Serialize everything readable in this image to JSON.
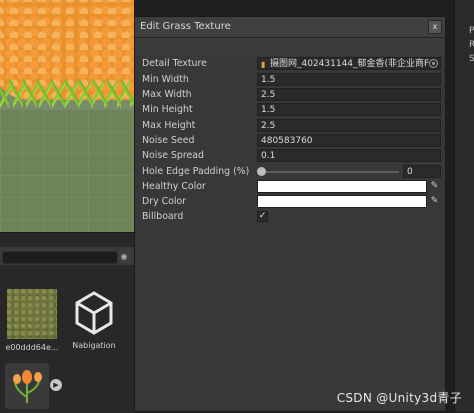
{
  "project_assets": [
    {
      "name": "e00ddd64e...",
      "kind": "texture"
    },
    {
      "name": "Nabigation",
      "kind": "unity-asset"
    }
  ],
  "project_search": {
    "clear_glyph": "◉"
  },
  "inspector_labels": [
    "P",
    "R",
    "S"
  ],
  "dialog": {
    "title": "Edit Grass Texture",
    "close_glyph": "x",
    "fields": {
      "detail_texture": {
        "label": "Detail Texture",
        "value": "摄图网_402431144_郁金香(非企业商F"
      },
      "min_width": {
        "label": "Min Width",
        "value": "1.5"
      },
      "max_width": {
        "label": "Max Width",
        "value": "2.5"
      },
      "min_height": {
        "label": "Min Height",
        "value": "1.5"
      },
      "max_height": {
        "label": "Max Height",
        "value": "2.5"
      },
      "noise_seed": {
        "label": "Noise Seed",
        "value": "480583760"
      },
      "noise_spread": {
        "label": "Noise Spread",
        "value": "0.1"
      },
      "hole_edge_padding": {
        "label": "Hole Edge Padding (%)",
        "value": "0",
        "fraction": 0
      },
      "healthy_color": {
        "label": "Healthy Color",
        "color": "#ffffff"
      },
      "dry_color": {
        "label": "Dry Color",
        "color": "#ffffff"
      },
      "billboard": {
        "label": "Billboard",
        "checked": true,
        "check_glyph": "✓"
      }
    }
  },
  "watermark": "CSDN @Unity3d青子"
}
